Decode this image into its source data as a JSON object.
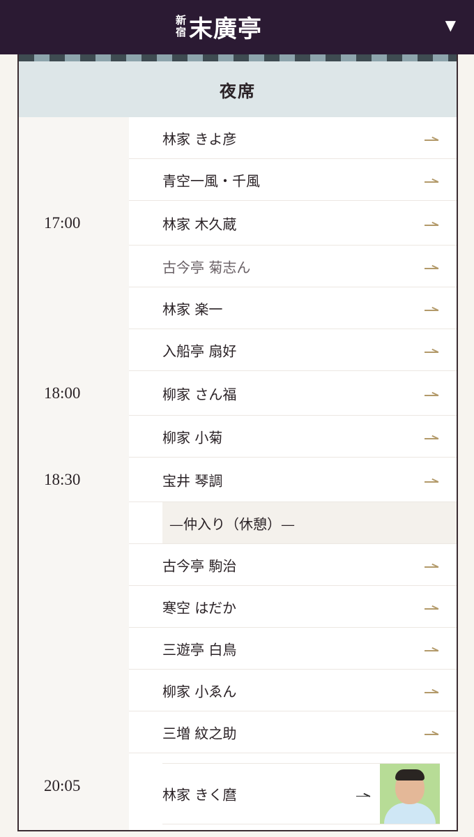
{
  "header": {
    "logo_small_1": "新",
    "logo_small_2": "宿",
    "logo_main": "末廣亭",
    "menu_icon": "▼"
  },
  "session": {
    "title": "夜席"
  },
  "performers": [
    {
      "time": "",
      "name": "林家 きよ彦"
    },
    {
      "time": "",
      "name": "青空一風・千風"
    },
    {
      "time": "17:00",
      "name": "林家 木久蔵"
    },
    {
      "time": "",
      "name": "古今亭 菊志ん"
    },
    {
      "time": "",
      "name": "林家 楽一"
    },
    {
      "time": "",
      "name": "入船亭 扇好"
    },
    {
      "time": "18:00",
      "name": "柳家 さん福"
    },
    {
      "time": "",
      "name": "柳家 小菊"
    },
    {
      "time": "18:30",
      "name": "宝井 琴調"
    },
    {
      "time": "",
      "name": "—仲入り（休憩）—"
    },
    {
      "time": "",
      "name": "古今亭 駒治"
    },
    {
      "time": "",
      "name": "寒空 はだか"
    },
    {
      "time": "",
      "name": "三遊亭 白鳥"
    },
    {
      "time": "",
      "name": "柳家 小ゑん"
    },
    {
      "time": "",
      "name": "三増 紋之助"
    },
    {
      "time": "20:05",
      "name": "林家 きく麿"
    }
  ],
  "colors": {
    "header_bg": "#2b1a33",
    "accent_arrow": "#b39a6a",
    "session_bg": "#dde6e8"
  },
  "icons": {
    "menu": "chevron-down-icon",
    "row": "arrow-right-icon"
  }
}
